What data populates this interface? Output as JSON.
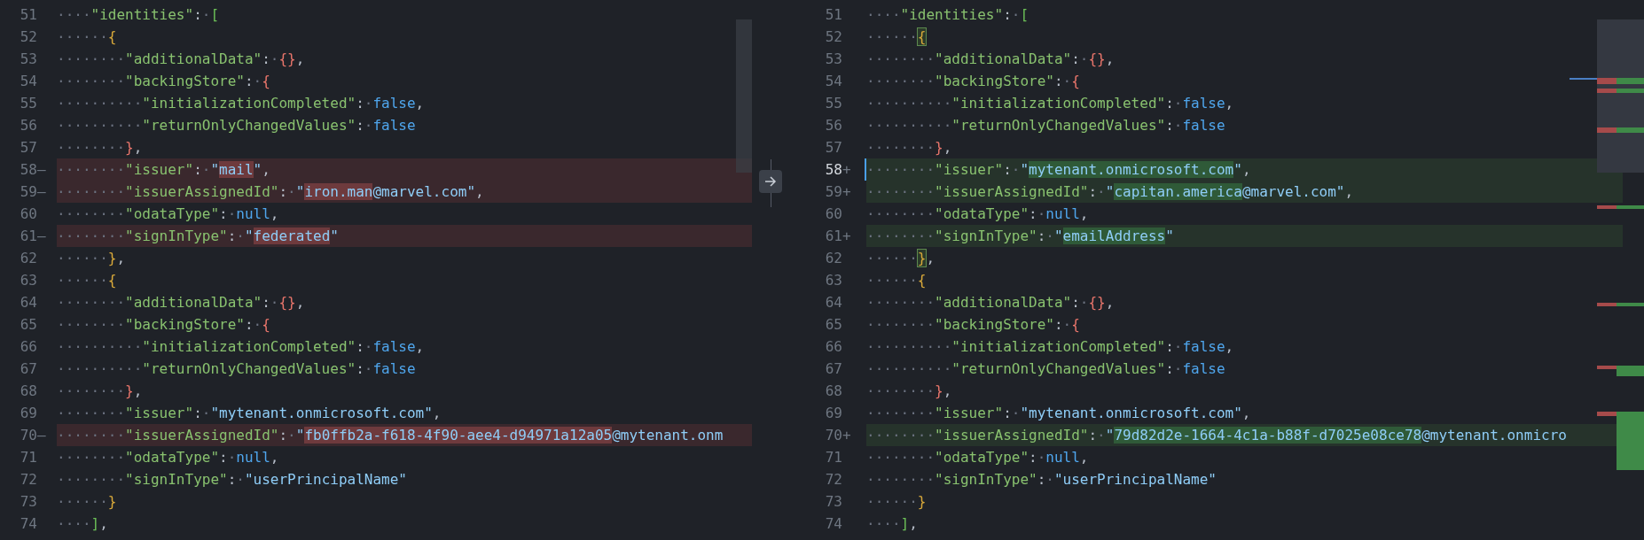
{
  "diff_editor": {
    "panes": [
      {
        "lines": [
          {
            "number": "51",
            "kind": "unchanged",
            "tokens": [
              {
                "kind": "ws",
                "text": "····"
              },
              {
                "kind": "key",
                "text": "\"identities\""
              },
              {
                "kind": "punct",
                "text": ":"
              },
              {
                "kind": "ws",
                "text": "·"
              },
              {
                "kind": "bracket-green",
                "text": "["
              }
            ]
          },
          {
            "number": "52",
            "kind": "unchanged",
            "tokens": [
              {
                "kind": "ws",
                "text": "······"
              },
              {
                "kind": "bracket-gold",
                "text": "{"
              }
            ]
          },
          {
            "number": "53",
            "kind": "unchanged",
            "tokens": [
              {
                "kind": "ws",
                "text": "········"
              },
              {
                "kind": "key",
                "text": "\"additionalData\""
              },
              {
                "kind": "punct",
                "text": ":"
              },
              {
                "kind": "ws",
                "text": "·"
              },
              {
                "kind": "bracket-red",
                "text": "{}"
              },
              {
                "kind": "punct",
                "text": ","
              }
            ]
          },
          {
            "number": "54",
            "kind": "unchanged",
            "tokens": [
              {
                "kind": "ws",
                "text": "········"
              },
              {
                "kind": "key",
                "text": "\"backingStore\""
              },
              {
                "kind": "punct",
                "text": ":"
              },
              {
                "kind": "ws",
                "text": "·"
              },
              {
                "kind": "bracket-red",
                "text": "{"
              }
            ]
          },
          {
            "number": "55",
            "kind": "unchanged",
            "tokens": [
              {
                "kind": "ws",
                "text": "··········"
              },
              {
                "kind": "key",
                "text": "\"initializationCompleted\""
              },
              {
                "kind": "punct",
                "text": ":"
              },
              {
                "kind": "ws",
                "text": "·"
              },
              {
                "kind": "keyword",
                "text": "false"
              },
              {
                "kind": "punct",
                "text": ","
              }
            ]
          },
          {
            "number": "56",
            "kind": "unchanged",
            "tokens": [
              {
                "kind": "ws",
                "text": "··········"
              },
              {
                "kind": "key",
                "text": "\"returnOnlyChangedValues\""
              },
              {
                "kind": "punct",
                "text": ":"
              },
              {
                "kind": "ws",
                "text": "·"
              },
              {
                "kind": "keyword",
                "text": "false"
              }
            ]
          },
          {
            "number": "57",
            "kind": "unchanged",
            "tokens": [
              {
                "kind": "ws",
                "text": "········"
              },
              {
                "kind": "bracket-red",
                "text": "}"
              },
              {
                "kind": "punct",
                "text": ","
              }
            ]
          },
          {
            "number": "58",
            "kind": "removed",
            "marker": "—",
            "tokens": [
              {
                "kind": "ws",
                "text": "········"
              },
              {
                "kind": "key",
                "text": "\"issuer\""
              },
              {
                "kind": "punct",
                "text": ":"
              },
              {
                "kind": "ws",
                "text": "·"
              },
              {
                "kind": "string",
                "text": "\""
              },
              {
                "kind": "string-changed",
                "text": "mail"
              },
              {
                "kind": "string",
                "text": "\""
              },
              {
                "kind": "punct",
                "text": ","
              }
            ]
          },
          {
            "number": "59",
            "kind": "removed",
            "marker": "—",
            "tokens": [
              {
                "kind": "ws",
                "text": "········"
              },
              {
                "kind": "key",
                "text": "\"issuerAssignedId\""
              },
              {
                "kind": "punct",
                "text": ":"
              },
              {
                "kind": "ws",
                "text": "·"
              },
              {
                "kind": "string",
                "text": "\""
              },
              {
                "kind": "string-changed",
                "text": "iron.man"
              },
              {
                "kind": "string",
                "text": "@marvel.com\""
              },
              {
                "kind": "punct",
                "text": ","
              }
            ]
          },
          {
            "number": "60",
            "kind": "unchanged",
            "tokens": [
              {
                "kind": "ws",
                "text": "········"
              },
              {
                "kind": "key",
                "text": "\"odataType\""
              },
              {
                "kind": "punct",
                "text": ":"
              },
              {
                "kind": "ws",
                "text": "·"
              },
              {
                "kind": "keyword",
                "text": "null"
              },
              {
                "kind": "punct",
                "text": ","
              }
            ]
          },
          {
            "number": "61",
            "kind": "removed",
            "marker": "—",
            "tokens": [
              {
                "kind": "ws",
                "text": "········"
              },
              {
                "kind": "key",
                "text": "\"signInType\""
              },
              {
                "kind": "punct",
                "text": ":"
              },
              {
                "kind": "ws",
                "text": "·"
              },
              {
                "kind": "string",
                "text": "\""
              },
              {
                "kind": "string-changed",
                "text": "federated"
              },
              {
                "kind": "string",
                "text": "\""
              }
            ]
          },
          {
            "number": "62",
            "kind": "unchanged",
            "tokens": [
              {
                "kind": "ws",
                "text": "······"
              },
              {
                "kind": "bracket-gold",
                "text": "}"
              },
              {
                "kind": "punct",
                "text": ","
              }
            ]
          },
          {
            "number": "63",
            "kind": "unchanged",
            "tokens": [
              {
                "kind": "ws",
                "text": "······"
              },
              {
                "kind": "bracket-gold",
                "text": "{"
              }
            ]
          },
          {
            "number": "64",
            "kind": "unchanged",
            "tokens": [
              {
                "kind": "ws",
                "text": "········"
              },
              {
                "kind": "key",
                "text": "\"additionalData\""
              },
              {
                "kind": "punct",
                "text": ":"
              },
              {
                "kind": "ws",
                "text": "·"
              },
              {
                "kind": "bracket-red",
                "text": "{}"
              },
              {
                "kind": "punct",
                "text": ","
              }
            ]
          },
          {
            "number": "65",
            "kind": "unchanged",
            "tokens": [
              {
                "kind": "ws",
                "text": "········"
              },
              {
                "kind": "key",
                "text": "\"backingStore\""
              },
              {
                "kind": "punct",
                "text": ":"
              },
              {
                "kind": "ws",
                "text": "·"
              },
              {
                "kind": "bracket-red",
                "text": "{"
              }
            ]
          },
          {
            "number": "66",
            "kind": "unchanged",
            "tokens": [
              {
                "kind": "ws",
                "text": "··········"
              },
              {
                "kind": "key",
                "text": "\"initializationCompleted\""
              },
              {
                "kind": "punct",
                "text": ":"
              },
              {
                "kind": "ws",
                "text": "·"
              },
              {
                "kind": "keyword",
                "text": "false"
              },
              {
                "kind": "punct",
                "text": ","
              }
            ]
          },
          {
            "number": "67",
            "kind": "unchanged",
            "tokens": [
              {
                "kind": "ws",
                "text": "··········"
              },
              {
                "kind": "key",
                "text": "\"returnOnlyChangedValues\""
              },
              {
                "kind": "punct",
                "text": ":"
              },
              {
                "kind": "ws",
                "text": "·"
              },
              {
                "kind": "keyword",
                "text": "false"
              }
            ]
          },
          {
            "number": "68",
            "kind": "unchanged",
            "tokens": [
              {
                "kind": "ws",
                "text": "········"
              },
              {
                "kind": "bracket-red",
                "text": "}"
              },
              {
                "kind": "punct",
                "text": ","
              }
            ]
          },
          {
            "number": "69",
            "kind": "unchanged",
            "tokens": [
              {
                "kind": "ws",
                "text": "········"
              },
              {
                "kind": "key",
                "text": "\"issuer\""
              },
              {
                "kind": "punct",
                "text": ":"
              },
              {
                "kind": "ws",
                "text": "·"
              },
              {
                "kind": "string",
                "text": "\"mytenant.onmicrosoft.com\""
              },
              {
                "kind": "punct",
                "text": ","
              }
            ]
          },
          {
            "number": "70",
            "kind": "removed",
            "marker": "—",
            "tokens": [
              {
                "kind": "ws",
                "text": "········"
              },
              {
                "kind": "key",
                "text": "\"issuerAssignedId\""
              },
              {
                "kind": "punct",
                "text": ":"
              },
              {
                "kind": "ws",
                "text": "·"
              },
              {
                "kind": "string",
                "text": "\""
              },
              {
                "kind": "string-changed",
                "text": "fb0ffb2a-f618-4f90-aee4-d94971a12a05"
              },
              {
                "kind": "string",
                "text": "@mytenant.onm"
              }
            ]
          },
          {
            "number": "71",
            "kind": "unchanged",
            "tokens": [
              {
                "kind": "ws",
                "text": "········"
              },
              {
                "kind": "key",
                "text": "\"odataType\""
              },
              {
                "kind": "punct",
                "text": ":"
              },
              {
                "kind": "ws",
                "text": "·"
              },
              {
                "kind": "keyword",
                "text": "null"
              },
              {
                "kind": "punct",
                "text": ","
              }
            ]
          },
          {
            "number": "72",
            "kind": "unchanged",
            "tokens": [
              {
                "kind": "ws",
                "text": "········"
              },
              {
                "kind": "key",
                "text": "\"signInType\""
              },
              {
                "kind": "punct",
                "text": ":"
              },
              {
                "kind": "ws",
                "text": "·"
              },
              {
                "kind": "string",
                "text": "\"userPrincipalName\""
              }
            ]
          },
          {
            "number": "73",
            "kind": "unchanged",
            "tokens": [
              {
                "kind": "ws",
                "text": "······"
              },
              {
                "kind": "bracket-gold",
                "text": "}"
              }
            ]
          },
          {
            "number": "74",
            "kind": "unchanged",
            "tokens": [
              {
                "kind": "ws",
                "text": "····"
              },
              {
                "kind": "bracket-green",
                "text": "]"
              },
              {
                "kind": "punct",
                "text": ","
              }
            ]
          }
        ]
      },
      {
        "lines": [
          {
            "number": "51",
            "kind": "unchanged",
            "tokens": [
              {
                "kind": "ws",
                "text": "····"
              },
              {
                "kind": "key",
                "text": "\"identities\""
              },
              {
                "kind": "punct",
                "text": ":"
              },
              {
                "kind": "ws",
                "text": "·"
              },
              {
                "kind": "bracket-green",
                "text": "["
              }
            ]
          },
          {
            "number": "52",
            "kind": "unchanged",
            "tokens": [
              {
                "kind": "ws",
                "text": "······"
              },
              {
                "kind": "bracket-match",
                "text": "{"
              }
            ]
          },
          {
            "number": "53",
            "kind": "unchanged",
            "tokens": [
              {
                "kind": "ws",
                "text": "········"
              },
              {
                "kind": "key",
                "text": "\"additionalData\""
              },
              {
                "kind": "punct",
                "text": ":"
              },
              {
                "kind": "ws",
                "text": "·"
              },
              {
                "kind": "bracket-red",
                "text": "{}"
              },
              {
                "kind": "punct",
                "text": ","
              }
            ]
          },
          {
            "number": "54",
            "kind": "unchanged",
            "tokens": [
              {
                "kind": "ws",
                "text": "········"
              },
              {
                "kind": "key",
                "text": "\"backingStore\""
              },
              {
                "kind": "punct",
                "text": ":"
              },
              {
                "kind": "ws",
                "text": "·"
              },
              {
                "kind": "bracket-red",
                "text": "{"
              }
            ]
          },
          {
            "number": "55",
            "kind": "unchanged",
            "tokens": [
              {
                "kind": "ws",
                "text": "··········"
              },
              {
                "kind": "key",
                "text": "\"initializationCompleted\""
              },
              {
                "kind": "punct",
                "text": ":"
              },
              {
                "kind": "ws",
                "text": "·"
              },
              {
                "kind": "keyword",
                "text": "false"
              },
              {
                "kind": "punct",
                "text": ","
              }
            ]
          },
          {
            "number": "56",
            "kind": "unchanged",
            "tokens": [
              {
                "kind": "ws",
                "text": "··········"
              },
              {
                "kind": "key",
                "text": "\"returnOnlyChangedValues\""
              },
              {
                "kind": "punct",
                "text": ":"
              },
              {
                "kind": "ws",
                "text": "·"
              },
              {
                "kind": "keyword",
                "text": "false"
              }
            ]
          },
          {
            "number": "57",
            "kind": "unchanged",
            "tokens": [
              {
                "kind": "ws",
                "text": "········"
              },
              {
                "kind": "bracket-red",
                "text": "}"
              },
              {
                "kind": "punct",
                "text": ","
              }
            ]
          },
          {
            "number": "58",
            "kind": "added",
            "marker": "+",
            "current": true,
            "tokens": [
              {
                "kind": "ws",
                "text": "········"
              },
              {
                "kind": "key",
                "text": "\"issuer\""
              },
              {
                "kind": "punct",
                "text": ":"
              },
              {
                "kind": "ws",
                "text": "·"
              },
              {
                "kind": "string",
                "text": "\""
              },
              {
                "kind": "string-changed",
                "text": "mytenant.onmicrosoft.com"
              },
              {
                "kind": "string",
                "text": "\""
              },
              {
                "kind": "punct",
                "text": ","
              }
            ]
          },
          {
            "number": "59",
            "kind": "added",
            "marker": "+",
            "tokens": [
              {
                "kind": "ws",
                "text": "········"
              },
              {
                "kind": "key",
                "text": "\"issuerAssignedId\""
              },
              {
                "kind": "punct",
                "text": ":"
              },
              {
                "kind": "ws",
                "text": "·"
              },
              {
                "kind": "string",
                "text": "\""
              },
              {
                "kind": "string-changed",
                "text": "capitan.america"
              },
              {
                "kind": "string",
                "text": "@marvel.com\""
              },
              {
                "kind": "punct",
                "text": ","
              }
            ]
          },
          {
            "number": "60",
            "kind": "unchanged",
            "tokens": [
              {
                "kind": "ws",
                "text": "········"
              },
              {
                "kind": "key",
                "text": "\"odataType\""
              },
              {
                "kind": "punct",
                "text": ":"
              },
              {
                "kind": "ws",
                "text": "·"
              },
              {
                "kind": "keyword",
                "text": "null"
              },
              {
                "kind": "punct",
                "text": ","
              }
            ]
          },
          {
            "number": "61",
            "kind": "added",
            "marker": "+",
            "tokens": [
              {
                "kind": "ws",
                "text": "········"
              },
              {
                "kind": "key",
                "text": "\"signInType\""
              },
              {
                "kind": "punct",
                "text": ":"
              },
              {
                "kind": "ws",
                "text": "·"
              },
              {
                "kind": "string",
                "text": "\""
              },
              {
                "kind": "string-changed",
                "text": "emailAddress"
              },
              {
                "kind": "string",
                "text": "\""
              }
            ]
          },
          {
            "number": "62",
            "kind": "unchanged",
            "tokens": [
              {
                "kind": "ws",
                "text": "······"
              },
              {
                "kind": "bracket-match",
                "text": "}"
              },
              {
                "kind": "punct",
                "text": ","
              }
            ]
          },
          {
            "number": "63",
            "kind": "unchanged",
            "tokens": [
              {
                "kind": "ws",
                "text": "······"
              },
              {
                "kind": "bracket-gold",
                "text": "{"
              }
            ]
          },
          {
            "number": "64",
            "kind": "unchanged",
            "tokens": [
              {
                "kind": "ws",
                "text": "········"
              },
              {
                "kind": "key",
                "text": "\"additionalData\""
              },
              {
                "kind": "punct",
                "text": ":"
              },
              {
                "kind": "ws",
                "text": "·"
              },
              {
                "kind": "bracket-red",
                "text": "{}"
              },
              {
                "kind": "punct",
                "text": ","
              }
            ]
          },
          {
            "number": "65",
            "kind": "unchanged",
            "tokens": [
              {
                "kind": "ws",
                "text": "········"
              },
              {
                "kind": "key",
                "text": "\"backingStore\""
              },
              {
                "kind": "punct",
                "text": ":"
              },
              {
                "kind": "ws",
                "text": "·"
              },
              {
                "kind": "bracket-red",
                "text": "{"
              }
            ]
          },
          {
            "number": "66",
            "kind": "unchanged",
            "tokens": [
              {
                "kind": "ws",
                "text": "··········"
              },
              {
                "kind": "key",
                "text": "\"initializationCompleted\""
              },
              {
                "kind": "punct",
                "text": ":"
              },
              {
                "kind": "ws",
                "text": "·"
              },
              {
                "kind": "keyword",
                "text": "false"
              },
              {
                "kind": "punct",
                "text": ","
              }
            ]
          },
          {
            "number": "67",
            "kind": "unchanged",
            "tokens": [
              {
                "kind": "ws",
                "text": "··········"
              },
              {
                "kind": "key",
                "text": "\"returnOnlyChangedValues\""
              },
              {
                "kind": "punct",
                "text": ":"
              },
              {
                "kind": "ws",
                "text": "·"
              },
              {
                "kind": "keyword",
                "text": "false"
              }
            ]
          },
          {
            "number": "68",
            "kind": "unchanged",
            "tokens": [
              {
                "kind": "ws",
                "text": "········"
              },
              {
                "kind": "bracket-red",
                "text": "}"
              },
              {
                "kind": "punct",
                "text": ","
              }
            ]
          },
          {
            "number": "69",
            "kind": "unchanged",
            "tokens": [
              {
                "kind": "ws",
                "text": "········"
              },
              {
                "kind": "key",
                "text": "\"issuer\""
              },
              {
                "kind": "punct",
                "text": ":"
              },
              {
                "kind": "ws",
                "text": "·"
              },
              {
                "kind": "string",
                "text": "\"mytenant.onmicrosoft.com\""
              },
              {
                "kind": "punct",
                "text": ","
              }
            ]
          },
          {
            "number": "70",
            "kind": "added",
            "marker": "+",
            "tokens": [
              {
                "kind": "ws",
                "text": "········"
              },
              {
                "kind": "key",
                "text": "\"issuerAssignedId\""
              },
              {
                "kind": "punct",
                "text": ":"
              },
              {
                "kind": "ws",
                "text": "·"
              },
              {
                "kind": "string",
                "text": "\""
              },
              {
                "kind": "string-changed",
                "text": "79d82d2e-1664-4c1a-b88f-d7025e08ce78"
              },
              {
                "kind": "string",
                "text": "@mytenant.onmicro"
              }
            ]
          },
          {
            "number": "71",
            "kind": "unchanged",
            "tokens": [
              {
                "kind": "ws",
                "text": "········"
              },
              {
                "kind": "key",
                "text": "\"odataType\""
              },
              {
                "kind": "punct",
                "text": ":"
              },
              {
                "kind": "ws",
                "text": "·"
              },
              {
                "kind": "keyword",
                "text": "null"
              },
              {
                "kind": "punct",
                "text": ","
              }
            ]
          },
          {
            "number": "72",
            "kind": "unchanged",
            "tokens": [
              {
                "kind": "ws",
                "text": "········"
              },
              {
                "kind": "key",
                "text": "\"signInType\""
              },
              {
                "kind": "punct",
                "text": ":"
              },
              {
                "kind": "ws",
                "text": "·"
              },
              {
                "kind": "string",
                "text": "\"userPrincipalName\""
              }
            ]
          },
          {
            "number": "73",
            "kind": "unchanged",
            "tokens": [
              {
                "kind": "ws",
                "text": "······"
              },
              {
                "kind": "bracket-gold",
                "text": "}"
              }
            ]
          },
          {
            "number": "74",
            "kind": "unchanged",
            "tokens": [
              {
                "kind": "ws",
                "text": "····"
              },
              {
                "kind": "bracket-green",
                "text": "]"
              },
              {
                "kind": "punct",
                "text": ","
              }
            ]
          }
        ]
      }
    ]
  }
}
